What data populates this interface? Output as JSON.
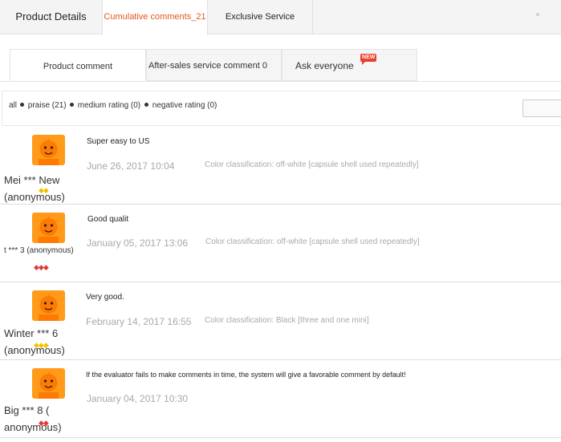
{
  "top_tabs": [
    {
      "label": "Product Details"
    },
    {
      "label": "Cumulative comments_21"
    },
    {
      "label": "Exclusive Service"
    }
  ],
  "sub_tabs": [
    {
      "label": "Product comment"
    },
    {
      "label": "After-sales service comment 0"
    },
    {
      "label": "Ask everyone",
      "badge": "NEW"
    }
  ],
  "filters": [
    {
      "label": "all"
    },
    {
      "label": "praise (21)"
    },
    {
      "label": "medium rating (0)"
    },
    {
      "label": "negative rating (0)"
    }
  ],
  "reviews": [
    {
      "nick_line1": "Mei *** New",
      "nick_line2": "(anonymous)",
      "gems": "◆◆",
      "gem_color": "#f2c200",
      "text": "Super easy to US",
      "date": "June 26, 2017 10:04",
      "spec": "Color classification: off-white [capsule shell used repeatedly]"
    },
    {
      "nick_line1": "t *** 3 (anonymous)",
      "nick_line2": "",
      "gems": "◆◆◆",
      "gem_color": "#e53a3a",
      "text": "Good qualit",
      "date": "January 05, 2017 13:06",
      "spec": "Color classification: off-white [capsule shell used repeatedly]"
    },
    {
      "nick_line1": "Winter *** 6",
      "nick_line2": "(anonymous)",
      "gems": "◆◆◆",
      "gem_color": "#f2c200",
      "text": "Very good.",
      "date": "February 14, 2017 16:55",
      "spec": "Color classification: Black [three and one mini]"
    },
    {
      "nick_line1": "Big *** 8 (",
      "nick_line2": "anonymous)",
      "gems": "◆◆",
      "gem_color": "#e53a3a",
      "text": "If the evaluator fails to make comments in time, the system will give a favorable comment by default!",
      "date": "January 04, 2017 10:30",
      "spec": ""
    }
  ],
  "icons": {
    "avatar": "orange-mascot-avatar-icon",
    "gem": "diamond-icon"
  }
}
